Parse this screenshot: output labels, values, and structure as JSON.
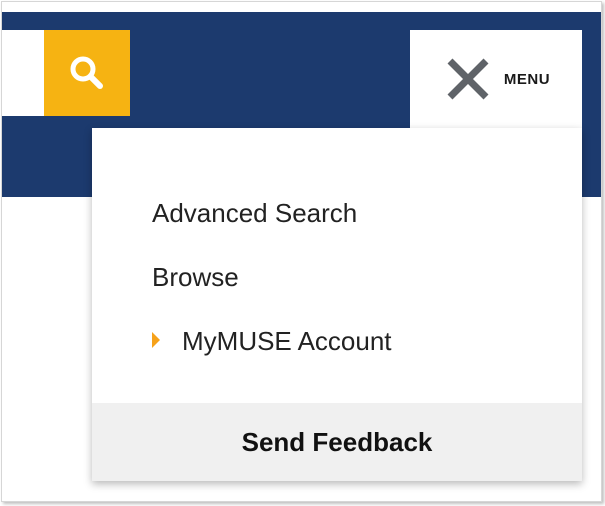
{
  "header": {
    "search_button_icon": "search-icon",
    "menu_toggle": {
      "icon": "close-icon",
      "label": "MENU"
    }
  },
  "menu": {
    "items": [
      {
        "label": "Advanced Search"
      },
      {
        "label": "Browse"
      },
      {
        "label": "MyMUSE Account",
        "icon": "caret-right-icon"
      }
    ],
    "feedback_label": "Send Feedback"
  },
  "colors": {
    "header_navy": "#1c3a6e",
    "search_yellow": "#f6b312",
    "caret_orange": "#f6a21a",
    "feedback_gray": "#f0f0f0",
    "close_icon_gray": "#5f6368"
  }
}
